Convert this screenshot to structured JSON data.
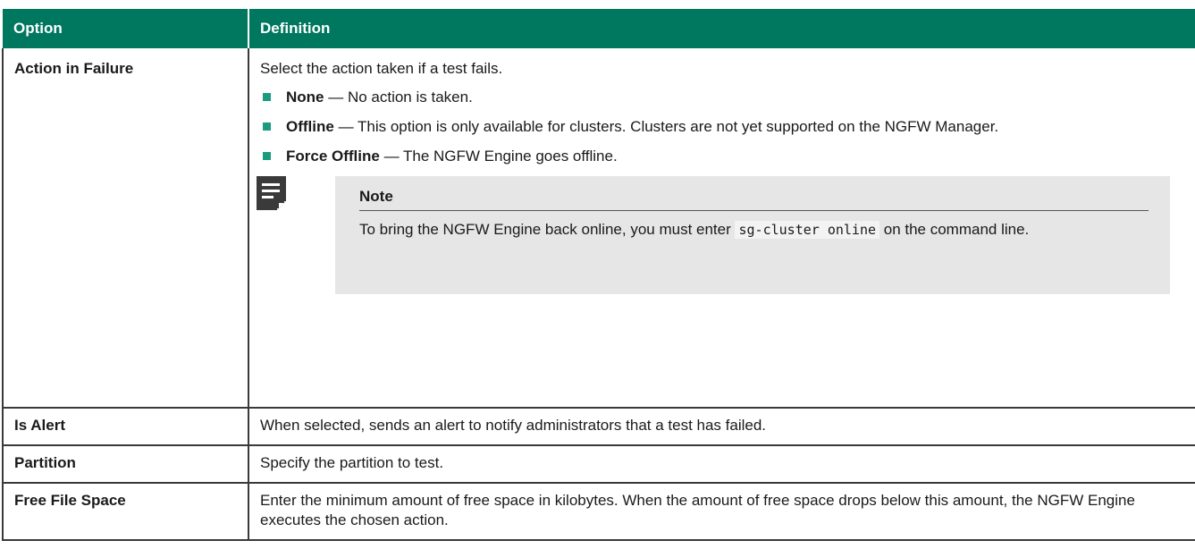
{
  "table": {
    "header": {
      "option": "Option",
      "definition": "Definition"
    },
    "rows": [
      {
        "option": "Action in Failure",
        "intro": "Select the action taken if a test fails.",
        "items": [
          {
            "term": "None",
            "desc": " — No action is taken."
          },
          {
            "term": "Offline",
            "desc": " — This option is only available for clusters. Clusters are not yet supported on the NGFW Manager."
          },
          {
            "term": "Force Offline",
            "desc": " — The NGFW Engine goes offline."
          }
        ],
        "note": {
          "title": "Note",
          "text_before": "To bring the NGFW Engine back online, you must enter ",
          "code": "sg-cluster online",
          "text_after": " on the command line."
        }
      },
      {
        "option": "Is Alert",
        "definition": "When selected, sends an alert to notify administrators that a test has failed."
      },
      {
        "option": "Partition",
        "definition": "Specify the partition to test."
      },
      {
        "option": "Free File Space",
        "definition": "Enter the minimum amount of free space in kilobytes. When the amount of free space drops below this amount, the NGFW Engine executes the chosen action."
      }
    ]
  },
  "colors": {
    "header_bg": "#00775f",
    "bullet": "#1a9b7e",
    "note_bg": "#e6e6e6"
  },
  "icons": {
    "note": "note-document-icon"
  }
}
